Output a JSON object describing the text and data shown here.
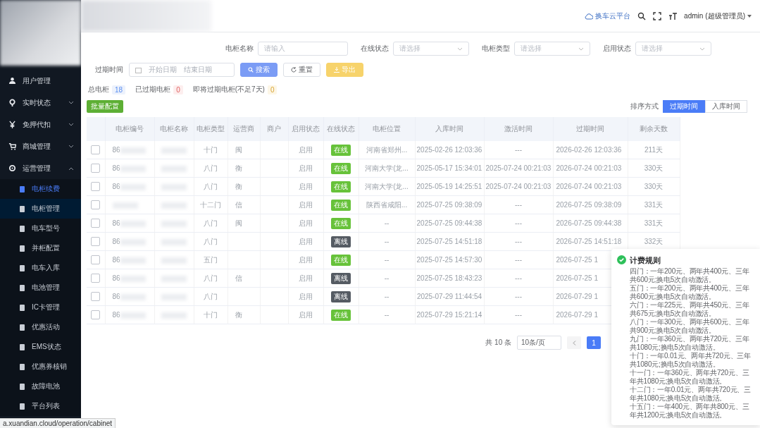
{
  "header": {
    "platform": "换车云平台",
    "user": "admin",
    "role": "(超级管理员)"
  },
  "sidebar": {
    "items": [
      {
        "label": "用户管理"
      },
      {
        "label": "实时状态",
        "expanded": false
      },
      {
        "label": "免押代扣",
        "expanded": false
      },
      {
        "label": "商城管理",
        "expanded": false
      },
      {
        "label": "运营管理",
        "expanded": true,
        "children": [
          {
            "label": "电柜续费",
            "selected": true,
            "hovered": false
          },
          {
            "label": "电柜管理",
            "selected": false,
            "hovered": true
          },
          {
            "label": "电车型号",
            "selected": false,
            "hovered": false
          },
          {
            "label": "并柜配置",
            "selected": false,
            "hovered": false
          },
          {
            "label": "电车入库",
            "selected": false,
            "hovered": false
          },
          {
            "label": "电池管理",
            "selected": false,
            "hovered": false
          },
          {
            "label": "IC卡管理",
            "selected": false,
            "hovered": false
          },
          {
            "label": "优惠活动",
            "selected": false,
            "hovered": false
          },
          {
            "label": "EMS状态",
            "selected": false,
            "hovered": false
          },
          {
            "label": "优惠券核销",
            "selected": false,
            "hovered": false
          },
          {
            "label": "故障电池",
            "selected": false,
            "hovered": false
          },
          {
            "label": "平台列表",
            "selected": false,
            "hovered": false
          }
        ]
      }
    ]
  },
  "filters": [
    {
      "label": "电柜名称",
      "kind": "input",
      "placeholder": "请输入"
    },
    {
      "label": "在线状态",
      "kind": "select",
      "placeholder": "请选择"
    },
    {
      "label": "电柜类型",
      "kind": "select",
      "placeholder": "请选择"
    },
    {
      "label": "启用状态",
      "kind": "select",
      "placeholder": "请选择"
    }
  ],
  "date_filter": {
    "label": "过期时间",
    "start_placeholder": "开始日期",
    "end_placeholder": "结束日期"
  },
  "buttons": [
    {
      "label": "搜索",
      "kind": "primary"
    },
    {
      "label": "重置",
      "kind": "default"
    },
    {
      "label": "导出",
      "kind": "warning"
    }
  ],
  "counts": [
    {
      "label": "总电柜",
      "value": "18",
      "kind": "info"
    },
    {
      "label": "已过期电柜",
      "value": "0",
      "kind": "danger"
    },
    {
      "label": "即将过期电柜(不足7天)",
      "value": "0",
      "kind": "warning"
    }
  ],
  "batch_button": "批量配置",
  "sort": {
    "label": "排序方式",
    "options": [
      {
        "label": "过期时间",
        "selected": true
      },
      {
        "label": "入库时间",
        "selected": false
      }
    ]
  },
  "table": {
    "columns": [
      "电柜编号",
      "电柜名称",
      "电柜类型",
      "运营商",
      "商户",
      "启用状态",
      "在线状态",
      "电柜位置",
      "入库时间",
      "激活时间",
      "过期时间",
      "剩余天数"
    ],
    "rows": [
      {
        "checked": false,
        "code": "86",
        "type": "十门",
        "operator": "闽",
        "enabled": "启用",
        "online": true,
        "online_label": "在线",
        "location": "河南省郑州...",
        "inbound": "2025-02-26 12:03:36",
        "activated": "---",
        "expiry": "2026-02-26 12:03:36",
        "days": "211天"
      },
      {
        "checked": false,
        "code": "86",
        "type": "八门",
        "operator": "衡",
        "enabled": "启用",
        "online": true,
        "online_label": "在线",
        "location": "河南大学(龙...",
        "inbound": "2025-05-17 15:34:01",
        "activated": "2025-07-24 00:21:03",
        "expiry": "2026-07-24 00:21:03",
        "days": "330天"
      },
      {
        "checked": false,
        "code": "86",
        "type": "八门",
        "operator": "衡",
        "enabled": "启用",
        "online": true,
        "online_label": "在线",
        "location": "河南大学(龙...",
        "inbound": "2025-05-19 14:25:51",
        "activated": "2025-07-24 00:21:03",
        "expiry": "2026-07-24 00:21:03",
        "days": "330天"
      },
      {
        "checked": false,
        "code": "",
        "type": "十二门",
        "operator": "信",
        "enabled": "启用",
        "online": true,
        "online_label": "在线",
        "location": "陕西省咸阳...",
        "inbound": "2025-07-25 09:38:09",
        "activated": "---",
        "expiry": "2026-07-25 09:38:09",
        "days": "331天"
      },
      {
        "checked": false,
        "code": "86",
        "type": "八门",
        "operator": "闽",
        "enabled": "启用",
        "online": true,
        "online_label": "在线",
        "location": "--",
        "inbound": "2025-07-25 09:44:38",
        "activated": "---",
        "expiry": "2026-07-25 09:44:38",
        "days": "331天"
      },
      {
        "checked": false,
        "code": "86",
        "type": "八门",
        "operator": "",
        "enabled": "启用",
        "online": false,
        "online_label": "离线",
        "location": "--",
        "inbound": "2025-07-25 14:51:18",
        "activated": "---",
        "expiry": "2026-07-25 14:51:18",
        "days": "332天"
      },
      {
        "checked": false,
        "code": "86",
        "type": "五门",
        "operator": "",
        "enabled": "启用",
        "online": true,
        "online_label": "在线",
        "location": "--",
        "inbound": "2025-07-25 14:57:30",
        "activated": "---",
        "expiry": "2026-07-25 1",
        "days": ""
      },
      {
        "checked": false,
        "code": "86",
        "type": "八门",
        "operator": "信",
        "enabled": "启用",
        "online": false,
        "online_label": "离线",
        "location": "--",
        "inbound": "2025-07-25 18:43:23",
        "activated": "---",
        "expiry": "2026-07-25 1",
        "days": ""
      },
      {
        "checked": false,
        "code": "86",
        "type": "八门",
        "operator": "",
        "enabled": "启用",
        "online": false,
        "online_label": "离线",
        "location": "--",
        "inbound": "2025-07-29 11:44:54",
        "activated": "---",
        "expiry": "2026-07-29 1",
        "days": ""
      },
      {
        "checked": false,
        "code": "86",
        "type": "十门",
        "operator": "衡",
        "enabled": "启用",
        "online": true,
        "online_label": "在线",
        "location": "--",
        "inbound": "2025-07-29 15:21:14",
        "activated": "---",
        "expiry": "2026-07-29 1",
        "days": ""
      }
    ]
  },
  "pagination": {
    "total": "共 10 条",
    "page_size": "10条/页",
    "pages": [
      {
        "label": "1",
        "selected": true
      }
    ]
  },
  "tooltip": {
    "title": "计费规则",
    "lines": [
      "四门：一年200元、两年共400元、三年共600元;换电5次自动激活。",
      "五门：一年200元、两年共400元、三年共600元;换电5次自动激活。",
      "六门：一年225元、两年共450元、三年共675元;换电5次自动激活。",
      "八门：一年300元、两年共600元、三年共900元;换电5次自动激活。",
      "九门：一年360元、两年共720元、三年共1080元;换电5次自动激活。",
      "十门：一年0.01元、两年共720元、三年共1080元;换电5次自动激活。",
      "十一门：一年360元、两年共720元、三年共1080元;换电5次自动激活。",
      "十二门：一年0.01元、两年共720元、三年共1080元;换电5次自动激活。",
      "十五门：一年400元、两年共800元、三年共1200元;换电5次自动激活。"
    ]
  },
  "status_url": "a.xuandian.cloud/operation/cabinet"
}
